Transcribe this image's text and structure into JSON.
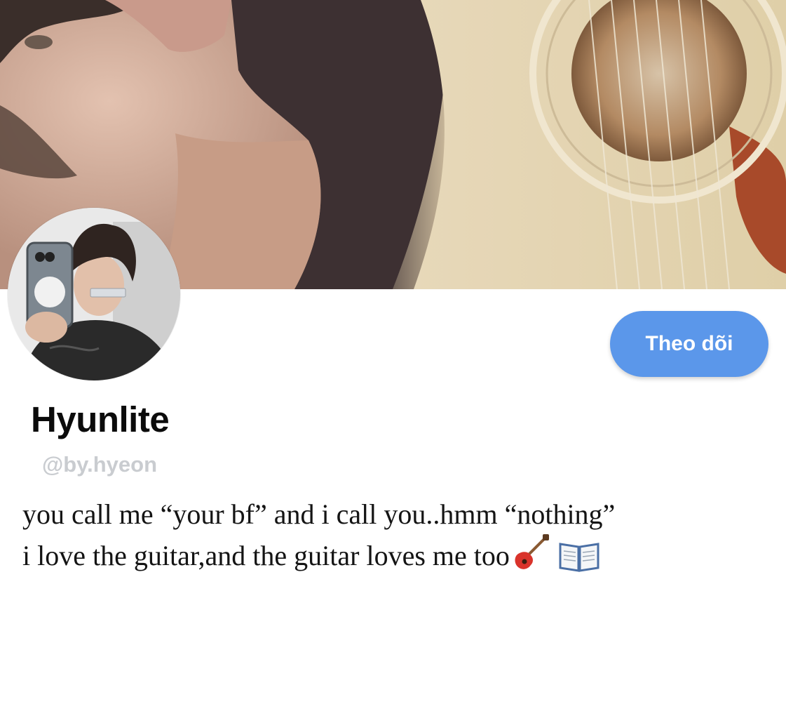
{
  "profile": {
    "follow_label": "Theo dõi",
    "display_name": "Hyunlite",
    "handle": "@by.hyeon",
    "bio_line1": "you call me “your bf” and i call you..hmm “nothing”",
    "bio_line2": "i love the guitar,and the guitar loves me too",
    "bio_emojis": [
      "guitar-icon",
      "open-book-icon"
    ]
  },
  "colors": {
    "follow_button": "#5b97ea",
    "follow_text": "#ffffff",
    "name_text": "#0b0b0b",
    "handle_text": "#c9ccd0"
  }
}
